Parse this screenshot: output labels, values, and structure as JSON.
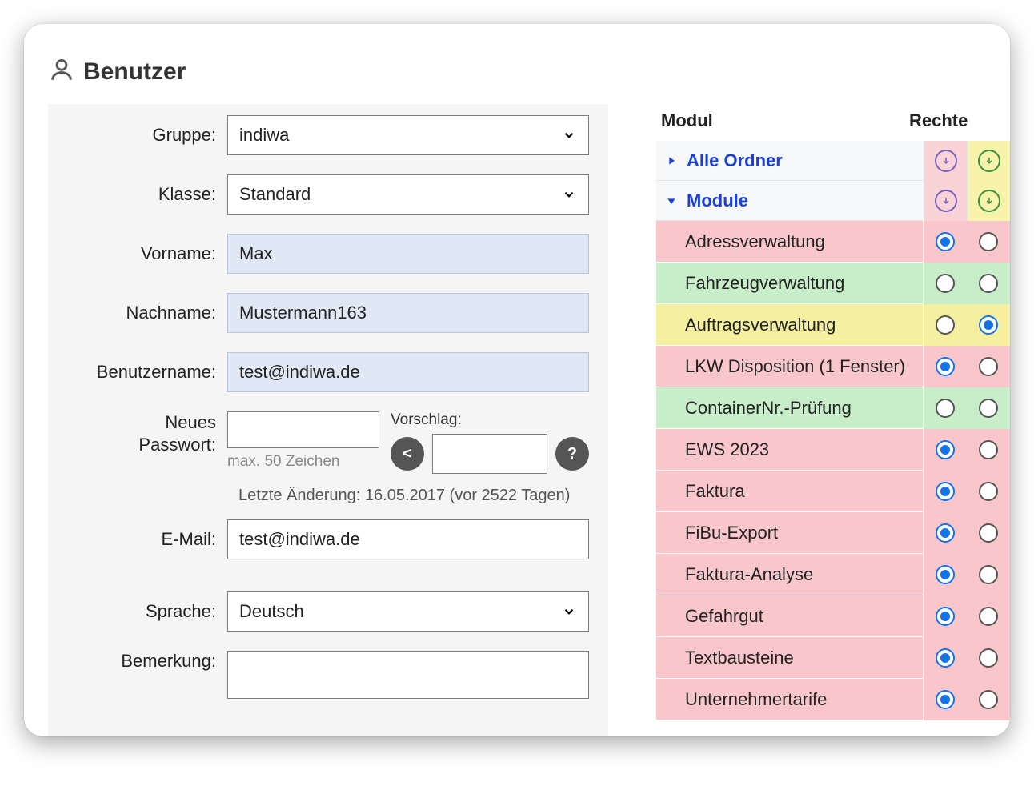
{
  "page_title": "Benutzer",
  "form": {
    "gruppe": {
      "label": "Gruppe:",
      "value": "indiwa"
    },
    "klasse": {
      "label": "Klasse:",
      "value": "Standard"
    },
    "vorname": {
      "label": "Vorname:",
      "value": "Max"
    },
    "nachname": {
      "label": "Nachname:",
      "value": "Mustermann163"
    },
    "benutzername": {
      "label": "Benutzername:",
      "value": "test@indiwa.de"
    },
    "neues_pw_label1": "Neues",
    "neues_pw_label2": "Passwort:",
    "pw_hint": "max. 50 Zeichen",
    "vorschlag_label": "Vorschlag:",
    "copy_btn": "<",
    "help_btn": "?",
    "letzte_aenderung": "Letzte Änderung: 16.05.2017 (vor 2522 Tagen)",
    "email": {
      "label": "E-Mail:",
      "value": "test@indiwa.de"
    },
    "sprache": {
      "label": "Sprache:",
      "value": "Deutsch"
    },
    "bemerkung": {
      "label": "Bemerkung:",
      "value": ""
    }
  },
  "rights": {
    "header_modul": "Modul",
    "header_rechte": "Rechte",
    "tree": [
      {
        "label": "Alle Ordner",
        "expanded": false
      },
      {
        "label": "Module",
        "expanded": true
      }
    ],
    "modules": [
      {
        "label": "Adressverwaltung",
        "color": "pink",
        "rcol1": true,
        "rcol2": false
      },
      {
        "label": "Fahrzeugverwaltung",
        "color": "green",
        "rcol1": false,
        "rcol2": false
      },
      {
        "label": "Auftragsverwaltung",
        "color": "yellow",
        "rcol1": false,
        "rcol2": true
      },
      {
        "label": "LKW Disposition (1 Fenster)",
        "color": "pink",
        "rcol1": true,
        "rcol2": false
      },
      {
        "label": "ContainerNr.-Prüfung",
        "color": "green",
        "rcol1": false,
        "rcol2": false
      },
      {
        "label": "EWS 2023",
        "color": "pink",
        "rcol1": true,
        "rcol2": false
      },
      {
        "label": "Faktura",
        "color": "pink",
        "rcol1": true,
        "rcol2": false
      },
      {
        "label": "FiBu-Export",
        "color": "pink",
        "rcol1": true,
        "rcol2": false
      },
      {
        "label": "Faktura-Analyse",
        "color": "pink",
        "rcol1": true,
        "rcol2": false
      },
      {
        "label": "Gefahrgut",
        "color": "pink",
        "rcol1": true,
        "rcol2": false
      },
      {
        "label": "Textbausteine",
        "color": "pink",
        "rcol1": true,
        "rcol2": false
      },
      {
        "label": "Unternehmertarife",
        "color": "pink",
        "rcol1": true,
        "rcol2": false
      }
    ]
  }
}
